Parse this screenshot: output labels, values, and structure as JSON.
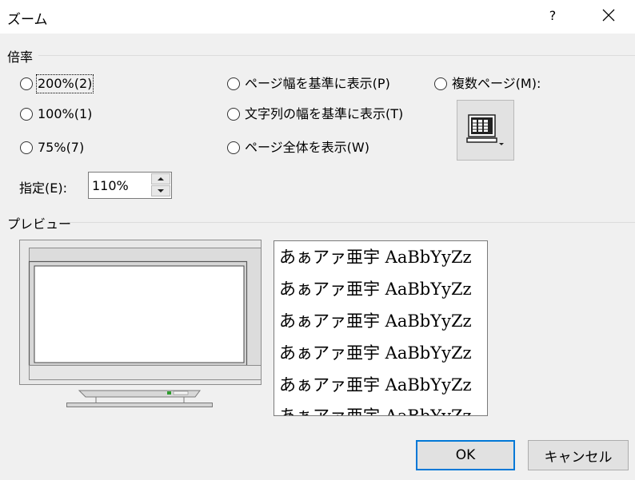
{
  "window": {
    "title": "ズーム",
    "help_label": "?",
    "close_icon": "close-icon"
  },
  "zoom_group": {
    "label": "倍率",
    "options": [
      {
        "label": "200%(2)",
        "selected": false
      },
      {
        "label": "100%(1)",
        "selected": false
      },
      {
        "label": "75%(7)",
        "selected": false
      },
      {
        "label": "ページ幅を基準に表示(P)",
        "selected": false
      },
      {
        "label": "文字列の幅を基準に表示(T)",
        "selected": false
      },
      {
        "label": "ページ全体を表示(W)",
        "selected": false
      },
      {
        "label": "複数ページ(M):",
        "selected": false
      }
    ],
    "specify_label": "指定(E):",
    "specify_value": "110%",
    "multi_page_icon": "multiple-pages-icon"
  },
  "preview": {
    "label": "プレビュー",
    "sample_lines": [
      "あぁアァ亜宇 AaBbYyZz",
      "あぁアァ亜宇 AaBbYyZz",
      "あぁアァ亜宇 AaBbYyZz",
      "あぁアァ亜宇 AaBbYyZz",
      "あぁアァ亜宇 AaBbYyZz",
      "あぁアァ亜宇 AaBbYyZz"
    ]
  },
  "buttons": {
    "ok": "OK",
    "cancel": "キャンセル"
  },
  "colors": {
    "dialog_bg": "#f0f0f0",
    "ok_border": "#0078d7"
  }
}
